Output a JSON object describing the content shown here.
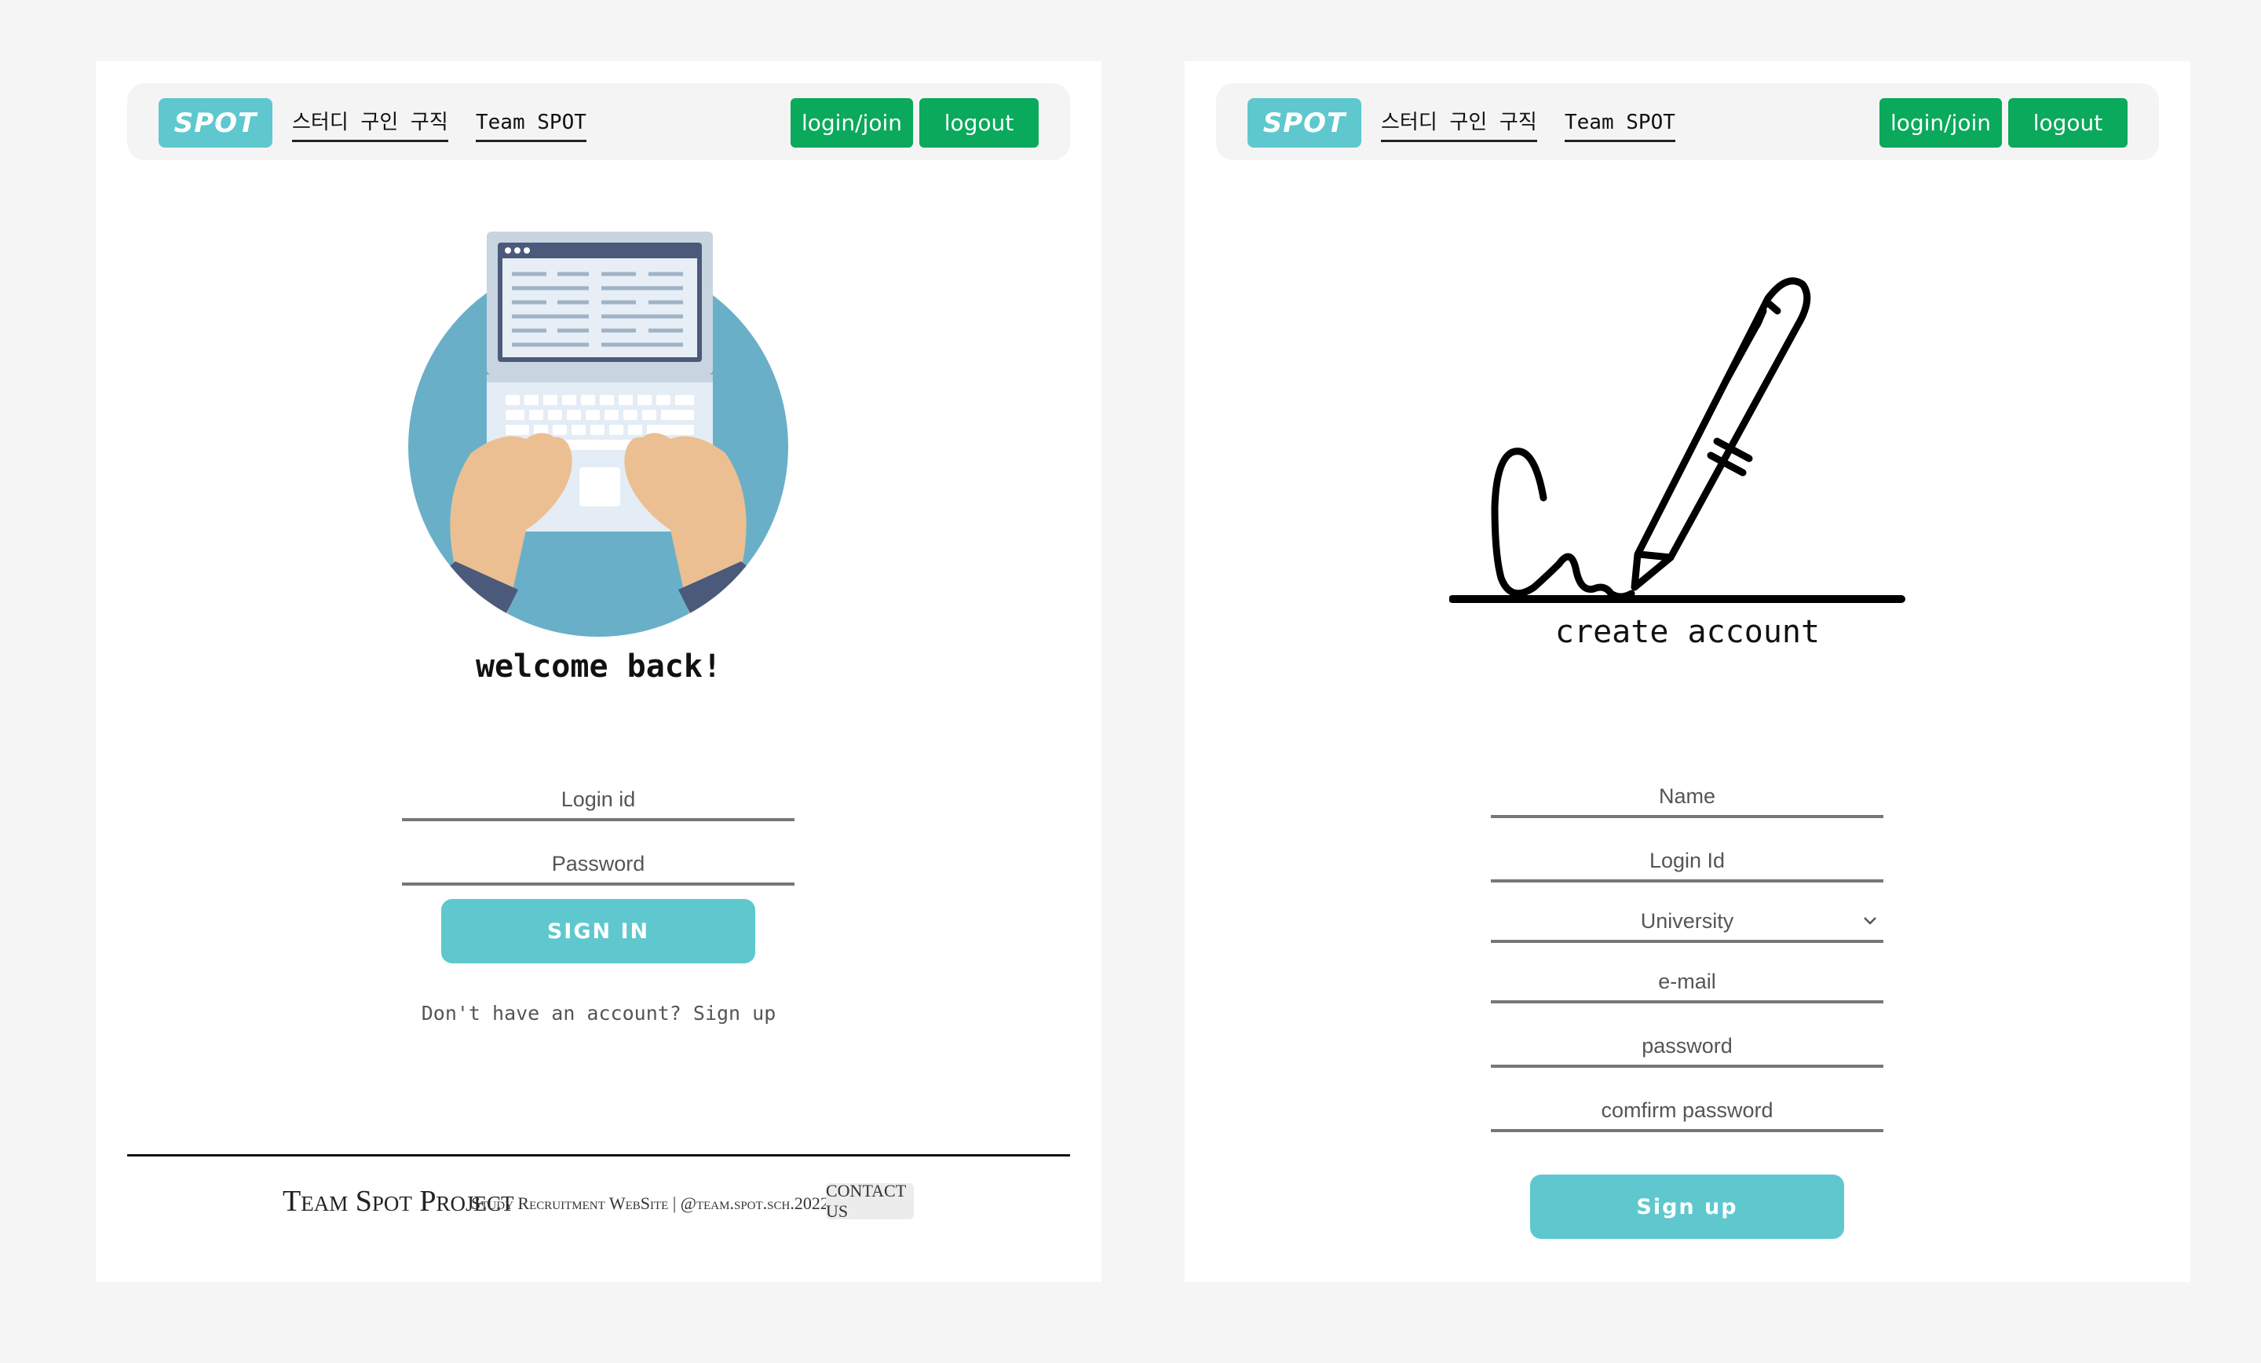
{
  "nav": {
    "logo": "SPOT",
    "link_recruit": "스터디 구인 구직",
    "link_team": "Team SPOT",
    "login_join": "login/join",
    "logout": "logout"
  },
  "login": {
    "heading": "welcome back!",
    "login_id_placeholder": "Login id",
    "password_placeholder": "Password",
    "submit": "SIGN IN",
    "signup_prompt": "Don't have an account? Sign up"
  },
  "footer": {
    "title": "Team Spot Project",
    "subtitle": "Study Recruitment WebSite  |  @team.spot.sch.2022",
    "contact": "CONTACT US"
  },
  "signup": {
    "heading": "create account",
    "name_placeholder": "Name",
    "login_id_placeholder": "Login Id",
    "university_selected": "University",
    "email_placeholder": "e-mail",
    "password_placeholder": "password",
    "confirm_placeholder": "comfirm password",
    "submit": "Sign up"
  },
  "colors": {
    "accent": "#5ec8ce",
    "nav_button": "#0aa95b",
    "page_bg": "#f5f5f5"
  },
  "icons": {
    "laptop": "laptop-typing-illustration",
    "signature": "pen-signature-illustration",
    "chevron": "chevron-down-icon"
  }
}
